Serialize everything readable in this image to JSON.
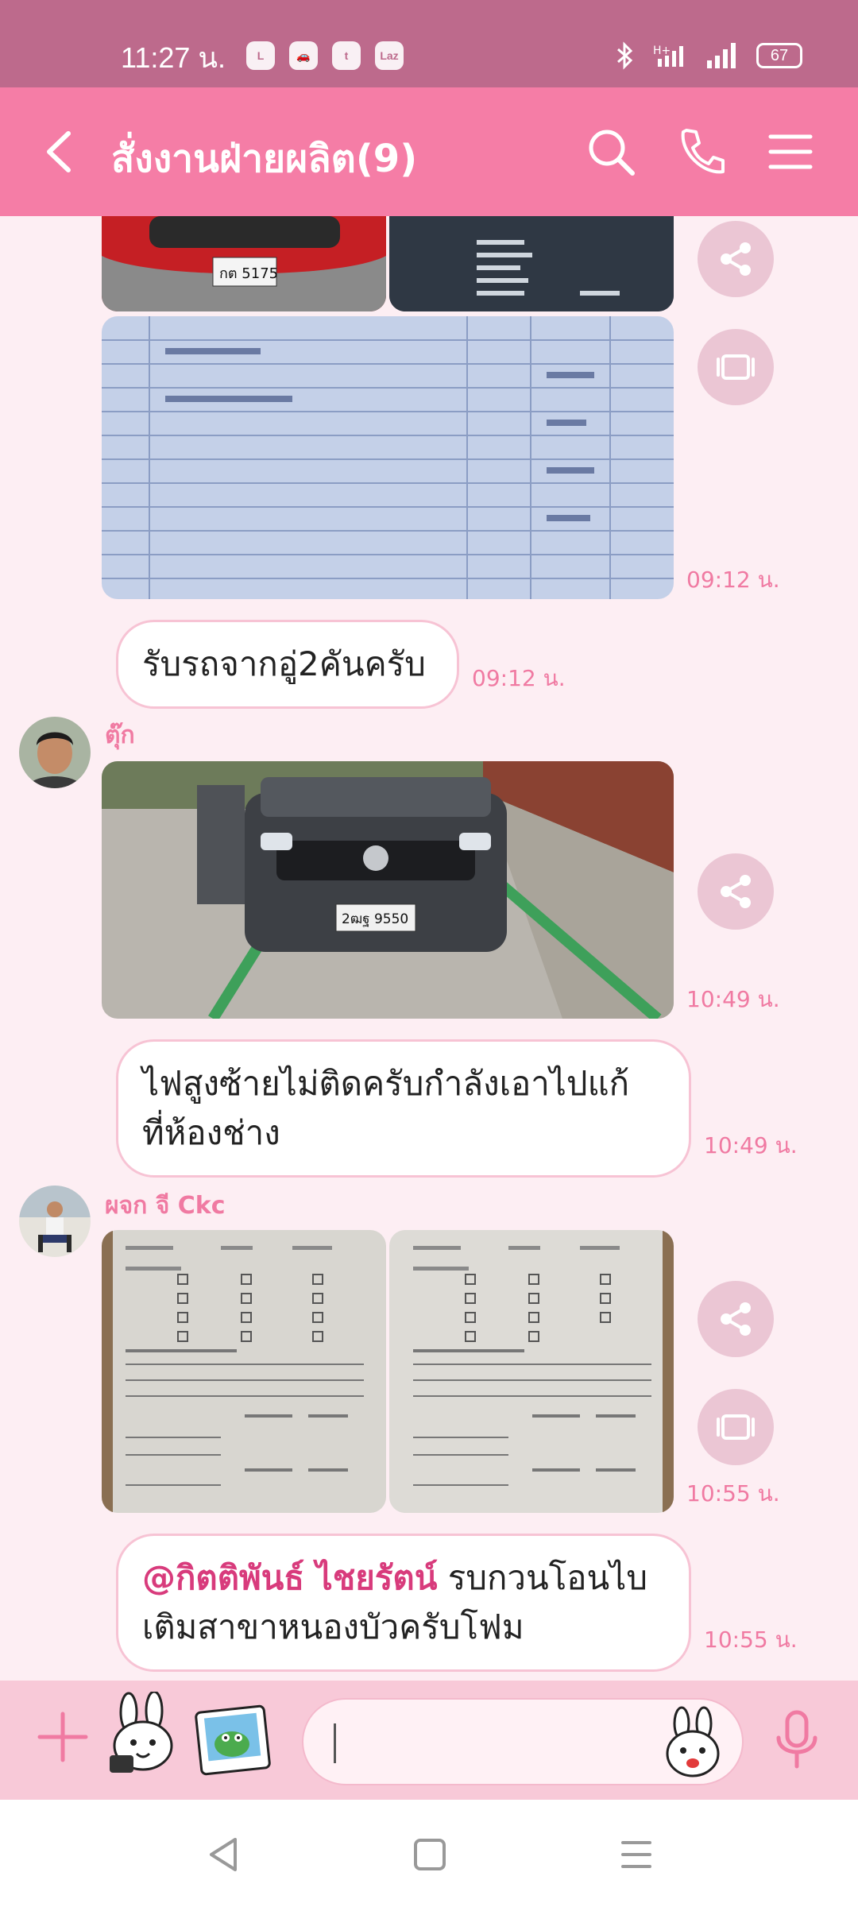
{
  "status_bar": {
    "time": "11:27 น.",
    "apps": [
      "LINE",
      "car",
      "twitter",
      "laz"
    ],
    "battery": "67"
  },
  "header": {
    "title": "สั่งงานฝ่ายผลิต(9)"
  },
  "messages": {
    "m1_time": "09:12 น.",
    "m2_text": "รับรถจากอู่2คันครับ",
    "m2_time": "09:12 น.",
    "sender2": "ตุ๊ก",
    "m3_time": "10:49 น.",
    "m4_text_line1": "ไฟสูงซ้ายไม่ติดครับกำลังเอาไปแก้",
    "m4_text_line2": "ที่ห้องช่าง",
    "m4_time": "10:49 น.",
    "sender3": "ผจก จี Ckc",
    "m5_time": "10:55 น.",
    "m6_mention": "@กิตติพันธ์ ไชยรัตน์",
    "m6_text_line1": " รบกวนโอนไบ",
    "m6_text_line2": "เติมสาขาหนองบัวครับโฟม",
    "m6_time": "10:55 น.",
    "plate1": "กต 5175",
    "plate2": "2ฒฐ 9550"
  },
  "colors": {
    "status_bar": "#bd6a8c",
    "header": "#f57da6",
    "chat_bg": "#fdeef3",
    "accent": "#f07aa2",
    "input_bar": "#f8c9d8"
  }
}
